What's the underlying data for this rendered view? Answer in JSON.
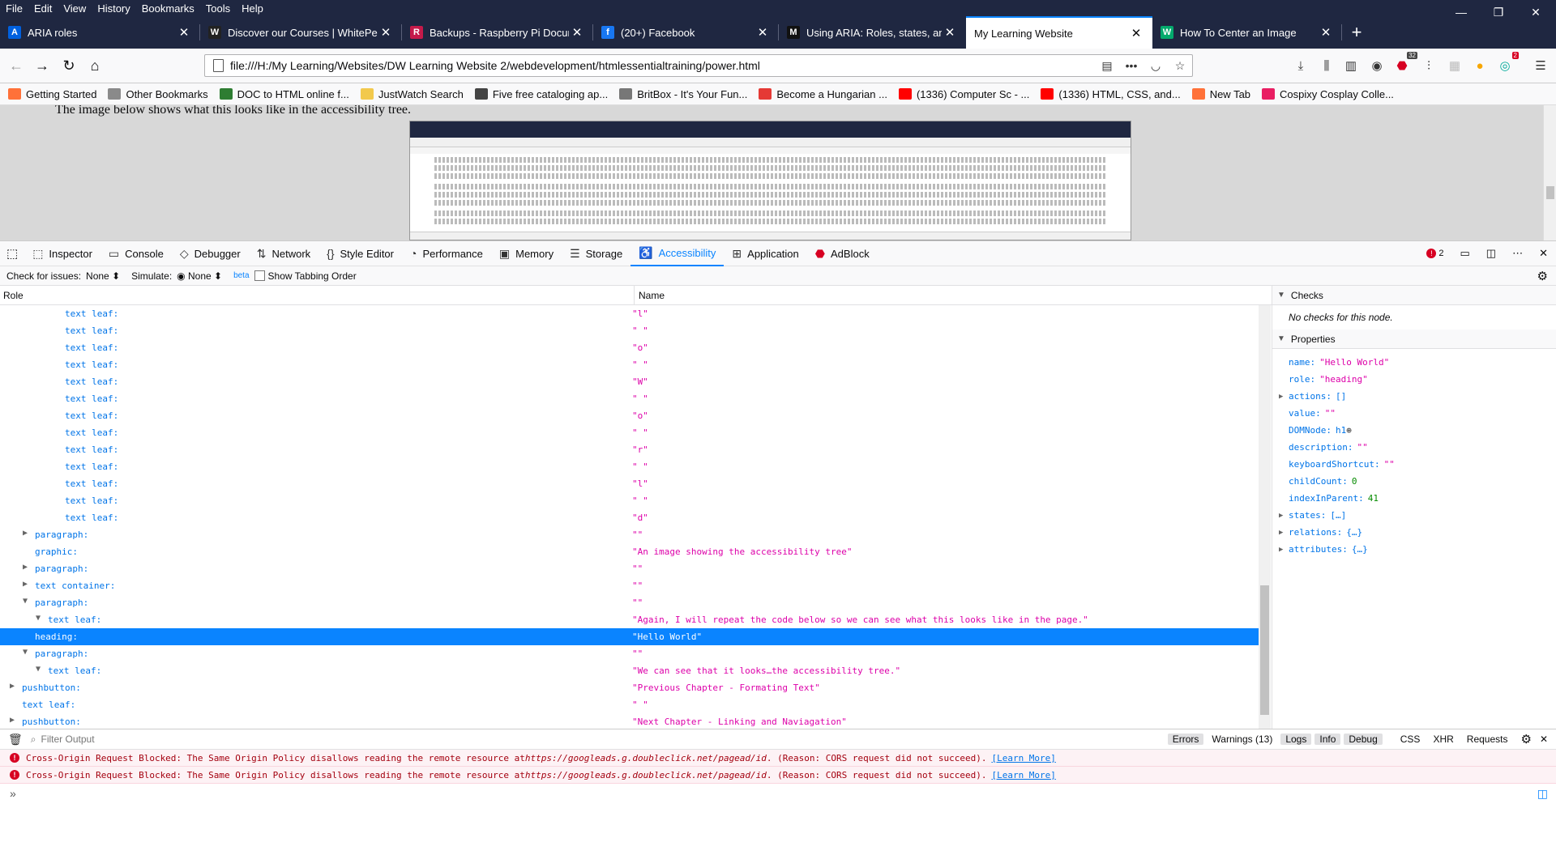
{
  "menubar": {
    "items": [
      "File",
      "Edit",
      "View",
      "History",
      "Bookmarks",
      "Tools",
      "Help"
    ]
  },
  "tabs": [
    {
      "label": "ARIA roles",
      "color": "#0060df",
      "glyph": "A"
    },
    {
      "label": "Discover our Courses | WhitePe",
      "color": "#222222",
      "glyph": "W"
    },
    {
      "label": "Backups - Raspberry Pi Docum",
      "color": "#c51a4a",
      "glyph": "R"
    },
    {
      "label": "(20+) Facebook",
      "color": "#1877f2",
      "glyph": "f"
    },
    {
      "label": "Using ARIA: Roles, states, and p",
      "color": "#111111",
      "glyph": "M"
    },
    {
      "label": "My Learning Website",
      "color": "#ffffff",
      "glyph": ""
    },
    {
      "label": "How To Center an Image",
      "color": "#04aa6d",
      "glyph": "W"
    }
  ],
  "navbar": {
    "url": "file:///H:/My Learning/Websites/DW Learning Website 2/webdevelopment/htmlessentialtraining/power.html",
    "badge_count": "32",
    "addon_badge": "2"
  },
  "bookmarks": [
    {
      "label": "Getting Started",
      "color": "#ff7139"
    },
    {
      "label": "Other Bookmarks",
      "color": "#8a8a8a"
    },
    {
      "label": "DOC to HTML online f...",
      "color": "#2e7d32"
    },
    {
      "label": "JustWatch Search",
      "color": "#f2c94c"
    },
    {
      "label": "Five free cataloging ap...",
      "color": "#444444"
    },
    {
      "label": "BritBox - It's Your Fun...",
      "color": "#777777"
    },
    {
      "label": "Become a Hungarian ...",
      "color": "#e53935"
    },
    {
      "label": "(1336) Computer Sc - ...",
      "color": "#ff0000"
    },
    {
      "label": "(1336) HTML, CSS, and...",
      "color": "#ff0000"
    },
    {
      "label": "New Tab",
      "color": "#ff7139"
    },
    {
      "label": "Cospixy Cosplay Colle...",
      "color": "#e91e63"
    }
  ],
  "page": {
    "text": "The image below shows what this looks like in the accessibility tree."
  },
  "devtools": {
    "tabs": [
      {
        "label": "Inspector",
        "icon": "inspector-icon",
        "glyph": "⬚"
      },
      {
        "label": "Console",
        "icon": "console-icon",
        "glyph": "▭"
      },
      {
        "label": "Debugger",
        "icon": "debugger-icon",
        "glyph": "◇"
      },
      {
        "label": "Network",
        "icon": "network-icon",
        "glyph": "⇅"
      },
      {
        "label": "Style Editor",
        "icon": "style-editor-icon",
        "glyph": "{}"
      },
      {
        "label": "Performance",
        "icon": "performance-icon",
        "glyph": "◔"
      },
      {
        "label": "Memory",
        "icon": "memory-icon",
        "glyph": "▣"
      },
      {
        "label": "Storage",
        "icon": "storage-icon",
        "glyph": "☰"
      },
      {
        "label": "Accessibility",
        "icon": "accessibility-icon",
        "glyph": "♿"
      },
      {
        "label": "Application",
        "icon": "application-icon",
        "glyph": "⊞"
      },
      {
        "label": "AdBlock",
        "icon": "adblock-icon",
        "glyph": "⬣"
      }
    ],
    "error_count": "2",
    "toolbar": {
      "check_label": "Check for issues:",
      "check_value": "None",
      "simulate_label": "Simulate:",
      "simulate_value": "None",
      "beta": "beta",
      "tabbing_label": "Show Tabbing Order"
    },
    "tree_headers": {
      "role": "Role",
      "name": "Name"
    },
    "tree_rows": [
      {
        "role": "text leaf:",
        "name": "\"l\"",
        "indent": 5,
        "tw": ""
      },
      {
        "role": "text leaf:",
        "name": "\" \"",
        "indent": 5,
        "tw": ""
      },
      {
        "role": "text leaf:",
        "name": "\"o\"",
        "indent": 5,
        "tw": ""
      },
      {
        "role": "text leaf:",
        "name": "\" \"",
        "indent": 5,
        "tw": ""
      },
      {
        "role": "text leaf:",
        "name": "\"W\"",
        "indent": 5,
        "tw": ""
      },
      {
        "role": "text leaf:",
        "name": "\" \"",
        "indent": 5,
        "tw": ""
      },
      {
        "role": "text leaf:",
        "name": "\"o\"",
        "indent": 5,
        "tw": ""
      },
      {
        "role": "text leaf:",
        "name": "\" \"",
        "indent": 5,
        "tw": ""
      },
      {
        "role": "text leaf:",
        "name": "\"r\"",
        "indent": 5,
        "tw": ""
      },
      {
        "role": "text leaf:",
        "name": "\" \"",
        "indent": 5,
        "tw": ""
      },
      {
        "role": "text leaf:",
        "name": "\"l\"",
        "indent": 5,
        "tw": ""
      },
      {
        "role": "text leaf:",
        "name": "\" \"",
        "indent": 5,
        "tw": ""
      },
      {
        "role": "text leaf:",
        "name": "\"d\"",
        "indent": 5,
        "tw": ""
      },
      {
        "role": "paragraph:",
        "name": "\"\"",
        "indent": 3,
        "tw": "▶"
      },
      {
        "role": "graphic:",
        "name": "\"An image showing the accessibility tree\"",
        "indent": 3,
        "tw": ""
      },
      {
        "role": "paragraph:",
        "name": "\"\"",
        "indent": 3,
        "tw": "▶"
      },
      {
        "role": "text container:",
        "name": "\"\"",
        "indent": 3,
        "tw": "▶"
      },
      {
        "role": "paragraph:",
        "name": "\"\"",
        "indent": 3,
        "tw": "▼"
      },
      {
        "role": "text leaf:",
        "name": "\"Again, I will repeat the code below so we can see what this looks like in the page.\"",
        "indent": 4,
        "tw": "▼"
      },
      {
        "role": "heading:",
        "name": "\"Hello World\"",
        "indent": 3,
        "tw": "",
        "selected": true
      },
      {
        "role": "paragraph:",
        "name": "\"\"",
        "indent": 3,
        "tw": "▼"
      },
      {
        "role": "text leaf:",
        "name": "\"We can see that it looks…the accessibility tree.\"",
        "indent": 4,
        "tw": "▼"
      },
      {
        "role": "pushbutton:",
        "name": "\"Previous Chapter - Formating Text\"",
        "indent": 2,
        "tw": "▶"
      },
      {
        "role": "text leaf:",
        "name": "\" \"",
        "indent": 2,
        "tw": ""
      },
      {
        "role": "pushbutton:",
        "name": "\"Next Chapter - Linking and Naviagation\"",
        "indent": 2,
        "tw": "▶"
      }
    ],
    "sidebar": {
      "checks_title": "Checks",
      "no_checks": "No checks for this node.",
      "properties_title": "Properties",
      "props": [
        {
          "k": "name:",
          "v": "\"Hello World\"",
          "t": "str",
          "tw": ""
        },
        {
          "k": "role:",
          "v": "\"heading\"",
          "t": "str",
          "tw": ""
        },
        {
          "k": "actions:",
          "v": "[]",
          "t": "obj",
          "tw": "▶"
        },
        {
          "k": "value:",
          "v": "\"\"",
          "t": "str",
          "tw": ""
        },
        {
          "k": "DOMNode:",
          "v": "h1",
          "t": "obj",
          "tw": "",
          "target": true
        },
        {
          "k": "description:",
          "v": "\"\"",
          "t": "str",
          "tw": ""
        },
        {
          "k": "keyboardShortcut:",
          "v": "\"\"",
          "t": "str",
          "tw": ""
        },
        {
          "k": "childCount:",
          "v": "0",
          "t": "num",
          "tw": ""
        },
        {
          "k": "indexInParent:",
          "v": "41",
          "t": "num",
          "tw": ""
        },
        {
          "k": "states:",
          "v": "[…]",
          "t": "obj",
          "tw": "▶"
        },
        {
          "k": "relations:",
          "v": "{…}",
          "t": "obj",
          "tw": "▶"
        },
        {
          "k": "attributes:",
          "v": "{…}",
          "t": "obj",
          "tw": "▶"
        }
      ]
    },
    "console": {
      "filter_placeholder": "Filter Output",
      "buttons": [
        "Errors",
        "Warnings (13)",
        "Logs",
        "Info",
        "Debug",
        "CSS",
        "XHR",
        "Requests"
      ],
      "messages": [
        {
          "pre": "Cross-Origin Request Blocked: The Same Origin Policy disallows reading the remote resource at ",
          "url": "https://googleads.g.doubleclick.net/pagead/id",
          "post": ". (Reason: CORS request did not succeed).",
          "link": "[Learn More]"
        },
        {
          "pre": "Cross-Origin Request Blocked: The Same Origin Policy disallows reading the remote resource at ",
          "url": "https://googleads.g.doubleclick.net/pagead/id",
          "post": ". (Reason: CORS request did not succeed).",
          "link": "[Learn More]"
        }
      ]
    }
  }
}
